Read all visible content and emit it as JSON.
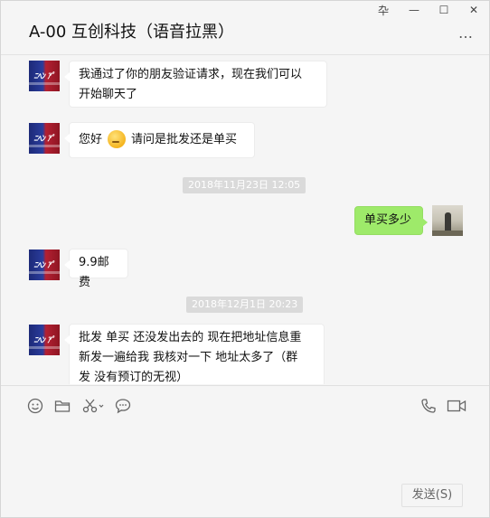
{
  "window": {
    "title": "A-00 互创科技（语音拉黑）",
    "controls": {
      "pin": "卆",
      "minimize": "—",
      "maximize": "☐",
      "close": "✕"
    },
    "more_label": "…"
  },
  "bot_avatar": {
    "label": "ﾆﾍﾝ ｱﾟ"
  },
  "messages": [
    {
      "from": "other",
      "lines": [
        "我通过了你的朋友验证请求，现在我们可以",
        "开始聊天了"
      ]
    },
    {
      "from": "other",
      "text_before": "您好",
      "emoji": "thinking-face",
      "text_after": "请问是批发还是单买"
    },
    {
      "type": "timestamp",
      "text": "2018年11月23日 12:05"
    },
    {
      "from": "me",
      "text": "单买多少"
    },
    {
      "from": "other",
      "text": "9.9邮费"
    },
    {
      "type": "timestamp",
      "text": "2018年12月1日 20:23"
    },
    {
      "from": "other",
      "lines": [
        "批发 单买 还没发出去的 现在把地址信息重",
        "新发一遍给我 我核对一下 地址太多了（群",
        "发 没有预订的无视）"
      ]
    }
  ],
  "toolbar": {
    "icons": [
      "emoji-icon",
      "folder-icon",
      "scissors-icon",
      "chat-bubble-icon",
      "phone-icon",
      "video-icon"
    ]
  },
  "input": {
    "value": ""
  },
  "send_button": {
    "label": "发送(S)"
  },
  "colors": {
    "my_bubble": "#9eea6a",
    "their_bubble": "#ffffff",
    "timestamp_bg": "#dadada",
    "background": "#f5f5f5"
  }
}
